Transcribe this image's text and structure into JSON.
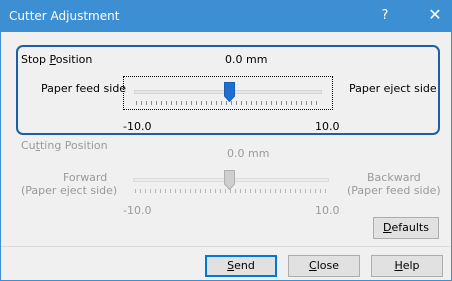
{
  "window": {
    "title": "Cutter Adjustment",
    "help_glyph": "?",
    "close_glyph": "✕"
  },
  "stop": {
    "label_prefix": "Stop ",
    "label_mnemonic": "P",
    "label_rest": "osition",
    "value": "0.0 mm",
    "left_label": "Paper feed side",
    "right_label": "Paper eject side",
    "min": "-10.0",
    "max": "10.0",
    "position": 0.0
  },
  "cutting": {
    "label_prefix": "Cu",
    "label_mnemonic": "t",
    "label_rest": "ting Position",
    "value": "0.0 mm",
    "left_label_1": "Forward",
    "left_label_2": "(Paper eject side)",
    "right_label_1": "Backward",
    "right_label_2": "(Paper feed side)",
    "min": "-10.0",
    "max": "10.0",
    "position": 0.0
  },
  "buttons": {
    "defaults_mnemonic": "D",
    "defaults_rest": "efaults",
    "send_mnemonic": "S",
    "send_rest": "end",
    "close_mnemonic": "C",
    "close_rest": "lose",
    "help_mnemonic": "H",
    "help_rest": "elp"
  },
  "colors": {
    "title_bar": "#3d8fd4",
    "focus": "#1c5fa8",
    "thumb": "#1f6fd1",
    "disabled_text": "#9a9a9a"
  }
}
